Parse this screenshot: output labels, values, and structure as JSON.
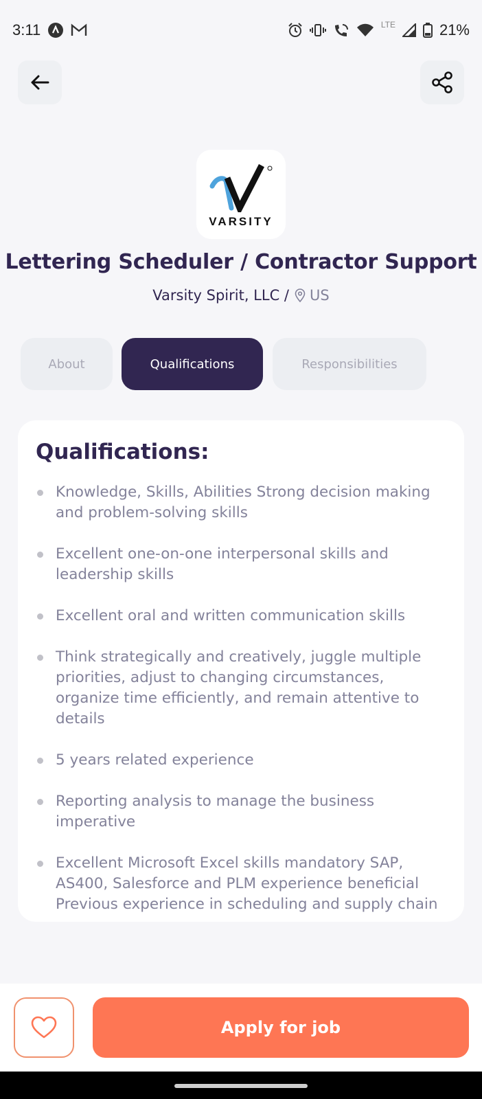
{
  "status_bar": {
    "time": "3:11",
    "battery": "21%",
    "network": "LTE",
    "icons": [
      "app-notification-icon",
      "gmail-icon",
      "alarm-icon",
      "vibrate-icon",
      "wifi-calling-icon",
      "wifi-icon",
      "signal-icon",
      "battery-icon"
    ]
  },
  "header": {
    "back_icon": "arrow-left-icon",
    "share_icon": "share-icon"
  },
  "company": {
    "logo_text": "VARSITY",
    "name": "Varsity Spirit, LLC /",
    "location": "US"
  },
  "job": {
    "title": "Lettering Scheduler / Contractor Support"
  },
  "tabs": [
    {
      "label": "About",
      "active": false
    },
    {
      "label": "Qualifications",
      "active": true
    },
    {
      "label": "Responsibilities",
      "active": false
    }
  ],
  "qualifications": {
    "heading": "Qualifications:",
    "items": [
      "Knowledge, Skills, Abilities Strong decision making and problem-solving skills",
      "Excellent one-on-one interpersonal skills and leadership skills",
      "Excellent oral and written communication skills",
      "Think strategically and creatively, juggle multiple priorities, adjust to changing circumstances, organize time efficiently, and remain attentive to details",
      "5 years related experience",
      "Reporting analysis to manage the business imperative",
      "Excellent Microsoft Excel skills mandatory SAP, AS400, Salesforce and PLM experience beneficial Previous experience in scheduling and supply chain"
    ]
  },
  "footer": {
    "favorite_icon": "heart-outline-icon",
    "apply_label": "Apply for job"
  },
  "colors": {
    "primary": "#312651",
    "accent": "#fe7654",
    "gray": "#83829a",
    "background": "#f6f6f9"
  }
}
